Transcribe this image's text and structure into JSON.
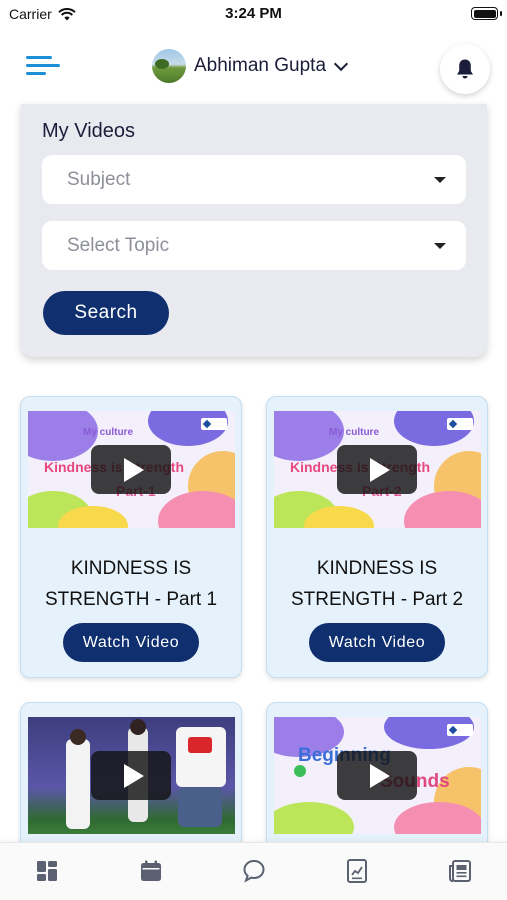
{
  "status_bar": {
    "carrier": "Carrier",
    "time": "3:24 PM"
  },
  "header": {
    "user_name": "Abhiman Gupta"
  },
  "filter": {
    "title": "My Videos",
    "subject_placeholder": "Subject",
    "topic_placeholder": "Select Topic",
    "search_label": "Search"
  },
  "videos": [
    {
      "title_line1": "KINDNESS IS",
      "title_line2": "STRENGTH - Part 1",
      "watch_label": "Watch Video",
      "thumb_label": "Kindness is Strength",
      "thumb_part": "Part-1"
    },
    {
      "title_line1": "KINDNESS IS",
      "title_line2": "STRENGTH - Part 2",
      "watch_label": "Watch Video",
      "thumb_label": "Kindness is Strength",
      "thumb_part": "Part-2"
    },
    {
      "thumb_kind": "photo"
    },
    {
      "thumb_label": "Beginning",
      "thumb_label2": "Sounds"
    }
  ],
  "colors": {
    "primary": "#0f2f6e",
    "accent": "#1d8fd6",
    "card_bg": "#e6f2fb",
    "filter_bg": "#e8eaf0"
  },
  "tab_bar": {
    "icons": [
      "dashboard-icon",
      "calendar-icon",
      "chat-icon",
      "report-icon",
      "news-icon"
    ]
  }
}
